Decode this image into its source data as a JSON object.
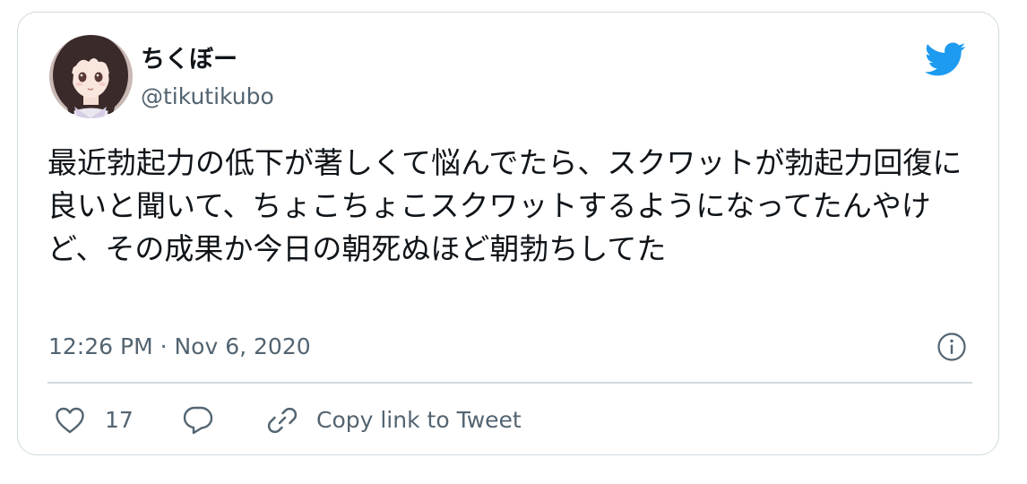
{
  "tweet": {
    "author": {
      "display_name": "ちくぼー",
      "handle": "@tikutikubo",
      "avatar_icon": "anime-girl-avatar-icon"
    },
    "text": "最近勃起力の低下が著しくて悩んでたら、スクワットが勃起力回復に良いと聞いて、ちょこちょこスクワットするようになってたんやけど、その成果か今日の朝死ぬほど朝勃ちしてた",
    "timestamp": "12:26 PM · Nov 6, 2020",
    "info_icon": "info-icon",
    "brand_icon": "twitter-bird-icon",
    "brand_color": "#1d9bf0",
    "actions": {
      "like_icon": "heart-icon",
      "like_count": "17",
      "reply_icon": "reply-icon",
      "copy_icon": "link-icon",
      "copy_label": "Copy link to Tweet"
    }
  },
  "colors": {
    "text_primary": "#0f1419",
    "text_secondary": "#536471",
    "border": "#cfd9de"
  }
}
